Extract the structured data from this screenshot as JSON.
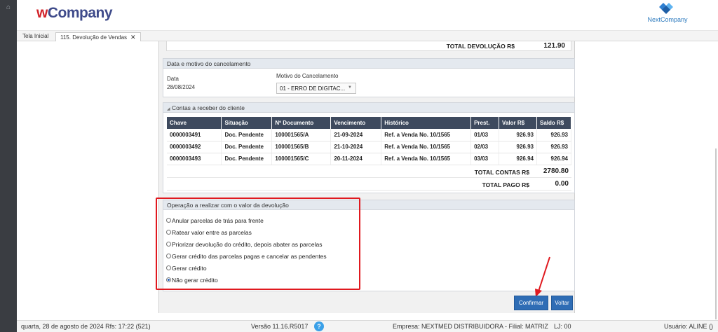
{
  "header": {
    "logo_w": "w",
    "logo_rest": "Company",
    "brand_right": "NextCompany"
  },
  "tabs": {
    "home": "Tela Inicial",
    "active": "115. Devolução de Vendas",
    "close": "✕"
  },
  "total_devolucao": {
    "label": "TOTAL DEVOLUÇÃO R$",
    "value": "121.90"
  },
  "cancel_section": {
    "title": "Data e motivo do cancelamento",
    "date_label": "Data",
    "date_value": "28/08/2024",
    "motivo_label": "Motivo do Cancelamento",
    "motivo_value": "01 - ERRO DE DIGITAC..."
  },
  "contas": {
    "title": "Contas a receber do cliente",
    "columns": [
      "Chave",
      "Situação",
      "Nº Documento",
      "Vencimento",
      "Histórico",
      "Prest.",
      "Valor R$",
      "Saldo R$"
    ],
    "rows": [
      [
        "0000003491",
        "Doc. Pendente",
        "100001565/A",
        "21-09-2024",
        "Ref. a Venda No. 10/1565",
        "01/03",
        "926.93",
        "926.93"
      ],
      [
        "0000003492",
        "Doc. Pendente",
        "100001565/B",
        "21-10-2024",
        "Ref. a Venda No. 10/1565",
        "02/03",
        "926.93",
        "926.93"
      ],
      [
        "0000003493",
        "Doc. Pendente",
        "100001565/C",
        "20-11-2024",
        "Ref. a Venda No. 10/1565",
        "03/03",
        "926.94",
        "926.94"
      ]
    ],
    "total_contas_label": "TOTAL CONTAS R$",
    "total_contas_value": "2780.80",
    "total_pago_label": "TOTAL PAGO R$",
    "total_pago_value": "0.00"
  },
  "operacao": {
    "title": "Operação a realizar com o valor da devolução",
    "options": [
      "Anular parcelas de trás para frente",
      "Ratear valor entre as parcelas",
      "Priorizar devolução do crédito, depois abater as parcelas",
      "Gerar crédito das parcelas pagas e cancelar as pendentes",
      "Gerar crédito",
      "Não gerar crédito"
    ],
    "selected_index": 5
  },
  "buttons": {
    "confirm": "Confirmar",
    "back": "Voltar"
  },
  "status": {
    "date": "quarta, 28 de agosto de 2024  Rfs: 17:22 (521)",
    "version": "Versão 11.16.R5017",
    "empresa": "Empresa: NEXTMED DISTRIBUIDORA - Filial: MATRIZ",
    "loja": "LJ: 00",
    "usuario": "Usuário: ALINE ()",
    "help": "?"
  },
  "colors": {
    "accent": "#2f6db5",
    "table_header": "#3e4a5e",
    "highlight": "#e0191f"
  }
}
